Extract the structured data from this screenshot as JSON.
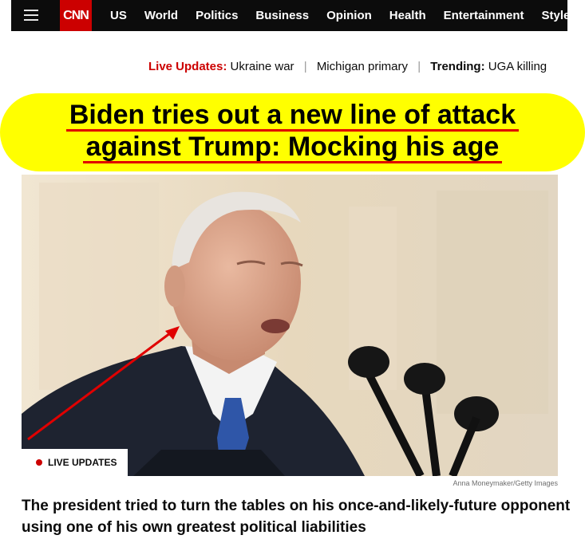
{
  "nav": {
    "logo": "CNN",
    "links": [
      "US",
      "World",
      "Politics",
      "Business",
      "Opinion",
      "Health",
      "Entertainment",
      "Style"
    ]
  },
  "ticker": {
    "live_label": "Live Updates:",
    "live_items": [
      "Ukraine war",
      "Michigan primary"
    ],
    "trending_label": "Trending:",
    "trending_items": [
      "UGA killing"
    ]
  },
  "headline": {
    "line1": "Biden tries out a new line of attack",
    "line2": "against Trump: Mocking his age"
  },
  "photo": {
    "badge": "LIVE UPDATES",
    "credit": "Anna Moneymaker/Getty Images",
    "annotation_color": "#e00000"
  },
  "dek": "The president tried to turn the tables on his once-and-likely-future opponent using one of his own greatest political liabilities",
  "colors": {
    "brand_red": "#cc0000",
    "nav_bg": "#0c0c0c",
    "highlight": "#ffff00"
  }
}
